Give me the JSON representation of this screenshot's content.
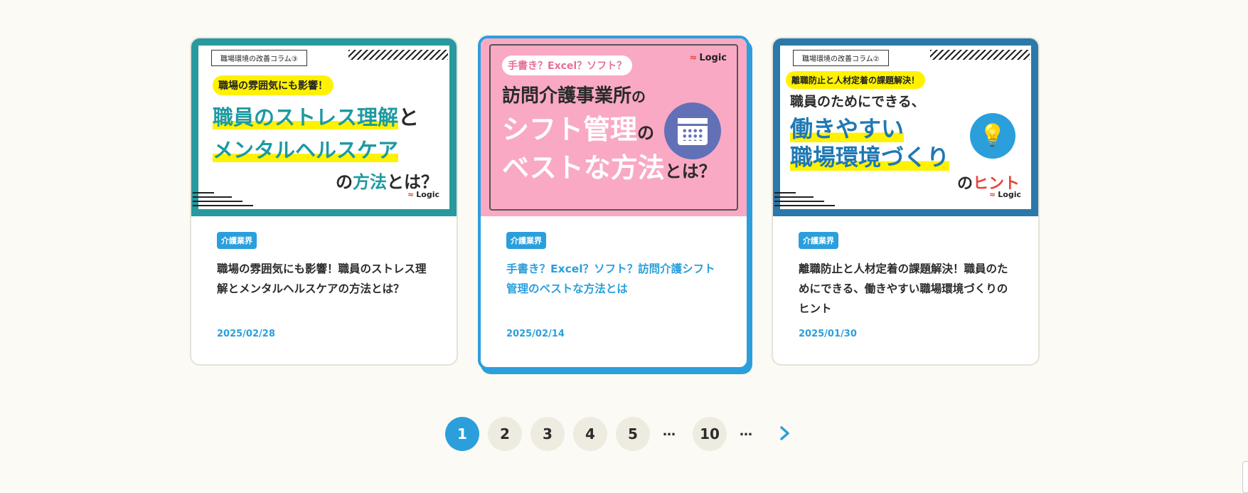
{
  "cards": [
    {
      "thumb": {
        "tag": "職場環境の改善コラム③",
        "pill": "職場の雰囲気にも影響！",
        "line1a": "職員のストレス理解",
        "line1b": "と",
        "line2": "メンタルヘルスケア",
        "line3a": "の",
        "line3b": "方法",
        "line3c": "とは？",
        "logo": "Logic"
      },
      "category": "介護業界",
      "title": "職場の雰囲気にも影響！職員のストレス理解とメンタルヘルスケアの方法とは？",
      "date": "2025/02/28"
    },
    {
      "thumb": {
        "pill": "手書き？Excel？ソフト？",
        "line1a": "訪問介護事業所",
        "line1b": "の",
        "line2a": "シフト管理",
        "line2b": "の",
        "line3a": "ベストな方法",
        "line3b": "とは？",
        "logo": "Logic"
      },
      "category": "介護業界",
      "title": "手書き？Excel？ソフト？訪問介護シフト管理のベストな方法とは",
      "date": "2025/02/14"
    },
    {
      "thumb": {
        "tag": "職場環境の改善コラム②",
        "pill": "離職防止と人材定着の課題解決！",
        "line1": "職員のためにできる、",
        "line2": "働きやすい",
        "line3": "職場環境づくり",
        "line4a": "の",
        "line4b": "ヒント",
        "logo": "Logic"
      },
      "category": "介護業界",
      "title": "離職防止と人材定着の課題解決！職員のためにできる、働きやすい職場環境づくりのヒント",
      "date": "2025/01/30"
    }
  ],
  "pagination": {
    "pages": [
      "1",
      "2",
      "3",
      "4",
      "5"
    ],
    "ellipsis": "…",
    "last": "10",
    "next_icon": "chevron-right-icon",
    "current": 1
  },
  "colors": {
    "accent": "#2b9fdc",
    "background": "#fbfaf4",
    "teal": "#27999f",
    "pink": "#f9a9c3",
    "highlight": "#fff200"
  }
}
